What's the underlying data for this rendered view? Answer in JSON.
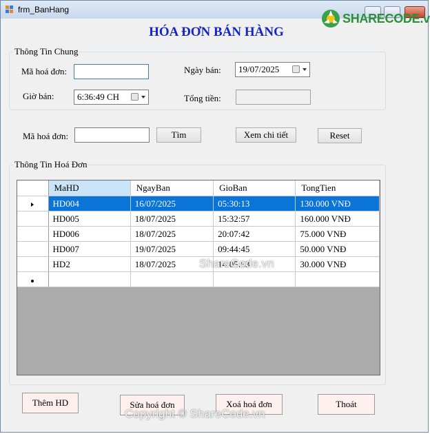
{
  "window": {
    "title": "frm_BanHang"
  },
  "logo": {
    "text": "SHARECODE.vn"
  },
  "form": {
    "heading": "HÓA ĐƠN BÁN HÀNG"
  },
  "general": {
    "legend": "Thông Tin Chung",
    "ma_hd_label": "Mã hoá đơn:",
    "ma_hd_value": "",
    "ngay_ban_label": "Ngày bán:",
    "ngay_ban_value": "19/07/2025",
    "gio_ban_label": "Giờ bán:",
    "gio_ban_value": "6:36:49 CH",
    "tong_tien_label": "Tổng tiền:",
    "tong_tien_value": ""
  },
  "search": {
    "ma_hd_label": "Mã hoá đơn:",
    "ma_hd_value": "",
    "find_label": "Tìm",
    "detail_label": "Xem chi tiết",
    "reset_label": "Reset"
  },
  "invoices": {
    "legend": "Thông Tin Hoá Đơn",
    "columns": [
      "MaHD",
      "NgayBan",
      "GioBan",
      "TongTien"
    ],
    "rows": [
      [
        "HD004",
        "16/07/2025",
        "05:30:13",
        "130.000 VNĐ"
      ],
      [
        "HD005",
        "18/07/2025",
        "15:32:57",
        "160.000 VNĐ"
      ],
      [
        "HD006",
        "18/07/2025",
        "20:07:42",
        "75.000 VNĐ"
      ],
      [
        "HD007",
        "19/07/2025",
        "09:44:45",
        "50.000 VNĐ"
      ],
      [
        "HD2",
        "18/07/2025",
        "14:05:53",
        "30.000 VNĐ"
      ]
    ],
    "selected_row": 0
  },
  "actions": {
    "add_label": "Thêm HD",
    "edit_label": "Sửa hoá đơn",
    "delete_label": "Xoá hoá đơn",
    "exit_label": "Thoát"
  },
  "watermarks": {
    "center": "ShareCode.vn",
    "footer": "Copyright © ShareCode.vn"
  },
  "colors": {
    "heading": "#1525c8",
    "selection": "#0a75d7",
    "grid_background": "#ababab",
    "logo_green": "#2e8e3a"
  }
}
